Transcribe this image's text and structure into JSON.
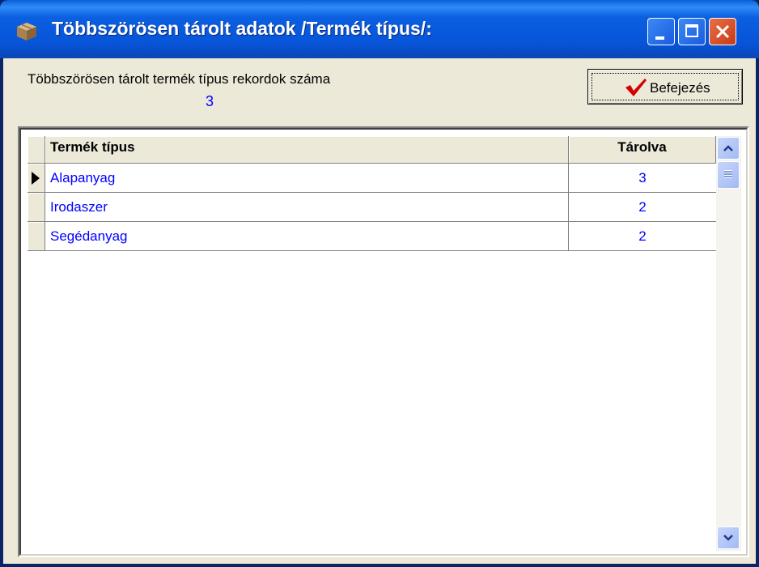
{
  "window": {
    "title": "Többszörösen tárolt adatok /Termék típus/:"
  },
  "summary": {
    "label": "Többszörösen tárolt termék típus rekordok száma",
    "value": "3"
  },
  "toolbar": {
    "finish_label": "Befejezés"
  },
  "table": {
    "headers": [
      "Termék típus",
      "Tárolva"
    ],
    "rows": [
      {
        "type": "Alapanyag",
        "count": "3",
        "current": true
      },
      {
        "type": "Irodaszer",
        "count": "2",
        "current": false
      },
      {
        "type": "Segédanyag",
        "count": "2",
        "current": false
      }
    ]
  },
  "icons": {
    "app": "box-icon",
    "finish": "checkmark-icon"
  },
  "colors": {
    "value_text": "#0000ff",
    "titlebar": "#0754d8",
    "close": "#c83a14",
    "check": "#d40000"
  }
}
